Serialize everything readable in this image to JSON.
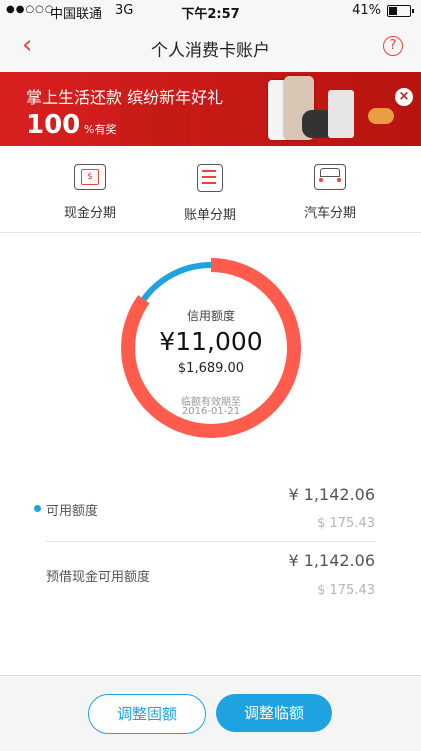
{
  "status_bar": {
    "signal": "●●○○○",
    "carrier": "中国联通",
    "network": "3G",
    "time": "下午2:57",
    "battery": "41%"
  },
  "nav": {
    "title": "个人消费卡账户",
    "back_icon": "chevron-left-icon",
    "help_icon": "question-circle-icon"
  },
  "banner": {
    "headline": "掌上生活还款  缤纷新年好礼",
    "percent": "100",
    "percent_unit": "%有奖",
    "close_icon": "close-icon"
  },
  "shortcuts": [
    {
      "label": "现金分期",
      "icon": "cash-icon"
    },
    {
      "label": "账单分期",
      "icon": "bill-icon"
    },
    {
      "label": "汽车分期",
      "icon": "car-icon"
    }
  ],
  "credit": {
    "label": "信用额度",
    "amount": "¥11,000",
    "amount_usd": "$1,689.00",
    "expiry_label": "临额有效期至",
    "expiry_date": "2016-01-21",
    "available_fraction_shown": 0.15
  },
  "available": {
    "label": "可用额度",
    "value_cny": "¥ 1,142.06",
    "value_usd": "$ 175.43"
  },
  "cash_advance": {
    "label": "预借现金可用额度",
    "value_cny": "¥ 1,142.06",
    "value_usd": "$ 175.43"
  },
  "footer": {
    "adjust_fixed": "调整固额",
    "adjust_temp": "调整临额"
  },
  "colors": {
    "accent_red": "#e8453c",
    "ring_red": "#ff5c4d",
    "blue": "#1ea3e0"
  }
}
